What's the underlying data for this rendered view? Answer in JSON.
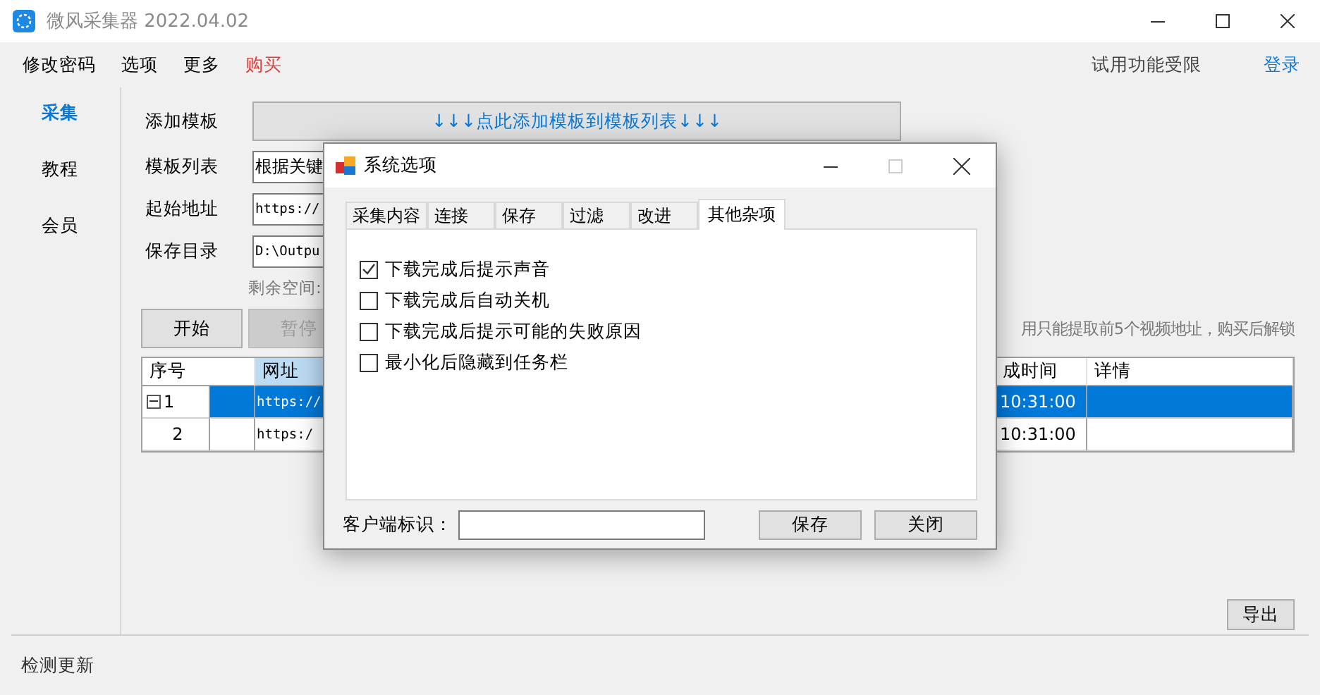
{
  "window": {
    "title": "微风采集器 2022.04.02"
  },
  "menu": [
    {
      "label": "修改密码",
      "kind": "normal"
    },
    {
      "label": "选项",
      "kind": "normal"
    },
    {
      "label": "更多",
      "kind": "normal"
    },
    {
      "label": "购买",
      "kind": "highlight"
    }
  ],
  "trial_notice": "试用功能受限",
  "login_link": "登录",
  "sidebar": {
    "items": [
      {
        "label": "采集",
        "selected": true
      },
      {
        "label": "教程",
        "selected": false
      },
      {
        "label": "会员",
        "selected": false
      }
    ]
  },
  "form": {
    "add_template": {
      "label": "添加模板",
      "button": "↓↓↓点此添加模板到模板列表↓↓↓"
    },
    "template_list": {
      "label": "模板列表",
      "value": "根据关键"
    },
    "start_url": {
      "label": "起始地址",
      "value": "https://"
    },
    "save_dir": {
      "label": "保存目录",
      "value": "D:\\Outpu"
    },
    "free_space": "剩余空间:"
  },
  "actions": [
    {
      "label": "开始",
      "disabled": false
    },
    {
      "label": "暂停",
      "disabled": true
    }
  ],
  "limit_notice": "用只能提取前5个视频地址，购买后解锁",
  "table": {
    "columns": [
      "序号",
      "网址",
      "成时间",
      "详情"
    ],
    "rows": [
      {
        "index": "1",
        "kind": "group",
        "selected": true,
        "url": "https://",
        "time": "10:31:00"
      },
      {
        "index": "2",
        "kind": "item",
        "selected": false,
        "url": "https:/",
        "time": "10:31:00"
      }
    ]
  },
  "export_button": "导出",
  "status": {
    "update_link": "检测更新"
  },
  "dialog": {
    "title": "系统选项",
    "tabs": [
      {
        "label": "采集内容",
        "selected": false
      },
      {
        "label": "连接",
        "selected": false
      },
      {
        "label": "保存",
        "selected": false
      },
      {
        "label": "过滤",
        "selected": false
      },
      {
        "label": "改进",
        "selected": false
      },
      {
        "label": "其他杂项",
        "selected": true
      }
    ],
    "options": [
      {
        "label": "下载完成后提示声音",
        "checked": true
      },
      {
        "label": "下载完成后自动关机",
        "checked": false
      },
      {
        "label": "下载完成后提示可能的失败原因",
        "checked": false
      },
      {
        "label": "最小化后隐藏到任务栏",
        "checked": false
      }
    ],
    "client_id": {
      "label": "客户端标识："
    },
    "buttons": [
      "保存",
      "关闭"
    ]
  }
}
